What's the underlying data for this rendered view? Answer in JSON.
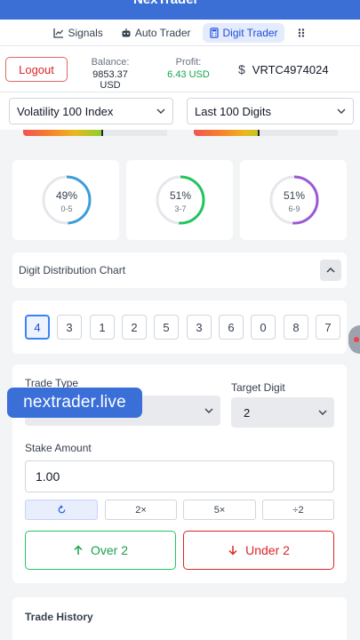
{
  "app": {
    "title": "NexTrader"
  },
  "nav": {
    "tabs": [
      {
        "label": "Signals",
        "icon": "chart-line-icon"
      },
      {
        "label": "Auto Trader",
        "icon": "robot-icon"
      },
      {
        "label": "Digit Trader",
        "icon": "calculator-icon",
        "active": true
      }
    ],
    "more_icon": "grid-dots-icon"
  },
  "account": {
    "logout_label": "Logout",
    "balance_label": "Balance:",
    "balance_value": "9853.37 USD",
    "profit_label": "Profit:",
    "profit_value": "6.43 USD",
    "currency_symbol": "$",
    "account_id": "VRTC4974024"
  },
  "selectors": {
    "market": "Volatility 100 Index",
    "ticks": "Last 100 Digits"
  },
  "rings": [
    {
      "percent": "49%",
      "range": "0-5",
      "value": 49,
      "color": "#3b9fd8"
    },
    {
      "percent": "51%",
      "range": "3-7",
      "value": 51,
      "color": "#22c55e"
    },
    {
      "percent": "51%",
      "range": "6-9",
      "value": 51,
      "color": "#9b59d6"
    }
  ],
  "distribution": {
    "title": "Digit Distribution Chart"
  },
  "digits": [
    "4",
    "3",
    "1",
    "2",
    "5",
    "3",
    "6",
    "0",
    "8",
    "7"
  ],
  "trade": {
    "trade_type_label": "Trade Type",
    "target_digit_label": "Target Digit",
    "target_digit_value": "2",
    "stake_label": "Stake Amount",
    "stake_value": "1.00",
    "multipliers": [
      "2×",
      "5×",
      "÷2"
    ],
    "over_label": "Over 2",
    "under_label": "Under 2"
  },
  "history": {
    "title": "Trade History"
  },
  "watermark": "nextrader.live",
  "colors": {
    "accent": "#3b6fd6",
    "green": "#16a34a",
    "red": "#dc2626"
  }
}
